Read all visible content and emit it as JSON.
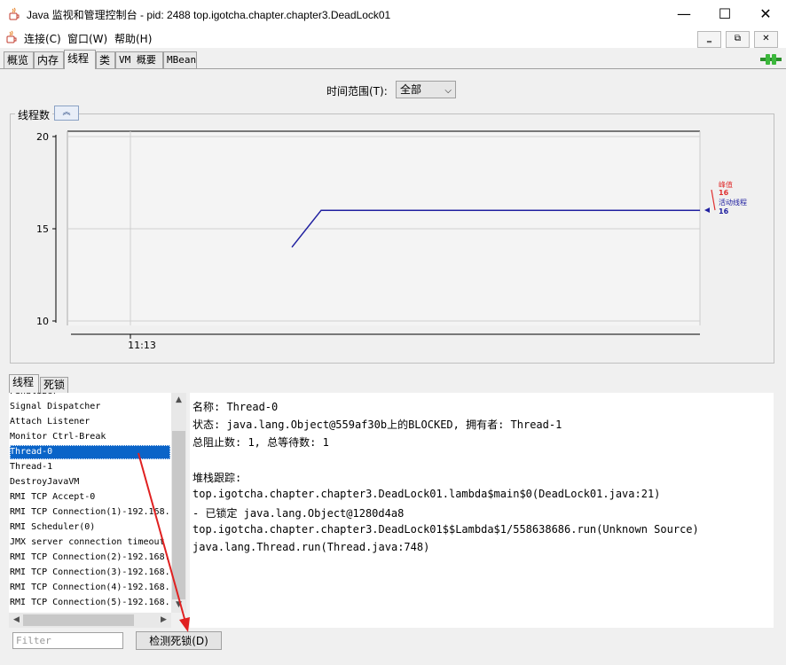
{
  "window": {
    "title": "Java 监视和管理控制台 - pid: 2488 top.igotcha.chapter.chapter3.DeadLock01",
    "minimize": "—",
    "maximize": "☐",
    "close": "✕"
  },
  "menu": {
    "items": [
      "连接(C)",
      "窗口(W)",
      "帮助(H)"
    ],
    "mdi": [
      "‗",
      "⧉",
      "✕"
    ]
  },
  "tabs": [
    {
      "label": "概览"
    },
    {
      "label": "内存"
    },
    {
      "label": "线程"
    },
    {
      "label": "类"
    },
    {
      "label": "VM 概要"
    },
    {
      "label": "MBean"
    }
  ],
  "time_range": {
    "label": "时间范围(T):",
    "value": "全部"
  },
  "panel": {
    "title": "线程数",
    "collapse_icon": "chevron-up-double-icon"
  },
  "chart_data": {
    "type": "line",
    "ylim": [
      10,
      20
    ],
    "yticks": [
      10,
      15,
      20
    ],
    "xticks": [
      "11:13"
    ],
    "series": [
      {
        "name": "峰值",
        "color": "#e03030",
        "last": "16"
      },
      {
        "name": "活动线程",
        "color": "#2020a0",
        "last": "16",
        "points": [
          [
            0,
            14
          ],
          [
            0.05,
            16
          ],
          [
            1,
            16
          ]
        ]
      }
    ]
  },
  "bottom_tabs": [
    {
      "label": "线程"
    },
    {
      "label": "死锁"
    }
  ],
  "threads": [
    "Finalizer",
    "Signal Dispatcher",
    "Attach Listener",
    "Monitor Ctrl-Break",
    "Thread-0",
    "Thread-1",
    "DestroyJavaVM",
    "RMI TCP Accept-0",
    "RMI TCP Connection(1)-192.168.",
    "RMI Scheduler(0)",
    "JMX server connection timeout",
    "RMI TCP Connection(2)-192.168.",
    "RMI TCP Connection(3)-192.168.",
    "RMI TCP Connection(4)-192.168.",
    "RMI TCP Connection(5)-192.168."
  ],
  "selected_thread": "Thread-0",
  "details": [
    "名称: Thread-0",
    "状态: java.lang.Object@559af30b上的BLOCKED, 拥有者: Thread-1",
    "总阻止数: 1, 总等待数: 1",
    "",
    "堆栈跟踪:",
    "top.igotcha.chapter.chapter3.DeadLock01.lambda$main$0(DeadLock01.java:21)",
    "   - 已锁定 java.lang.Object@1280d4a8",
    "top.igotcha.chapter.chapter3.DeadLock01$$Lambda$1/558638686.run(Unknown Source)",
    "java.lang.Thread.run(Thread.java:748)"
  ],
  "filter": {
    "placeholder": "Filter",
    "value": ""
  },
  "detect_button": "检测死锁(D)"
}
